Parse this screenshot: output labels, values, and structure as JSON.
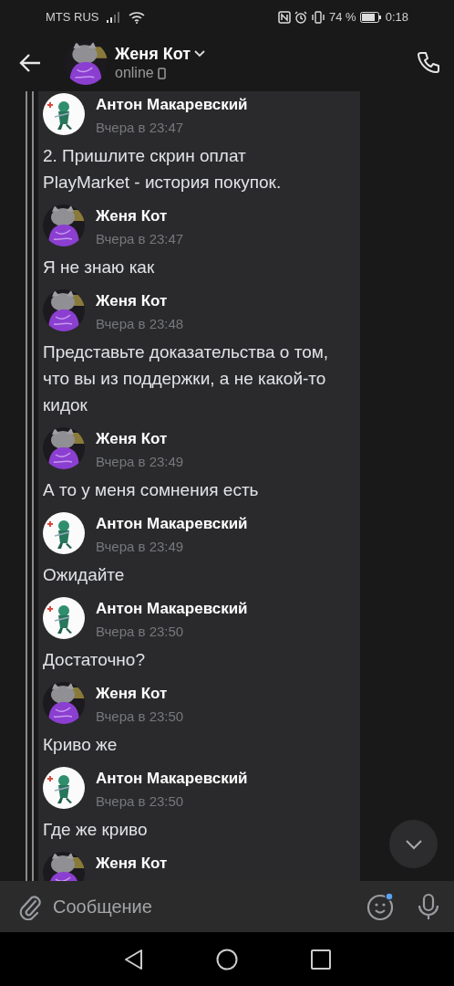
{
  "status_bar": {
    "carrier": "MTS RUS",
    "battery_text": "74 %",
    "time": "0:18"
  },
  "header": {
    "title": "Женя Кот",
    "status": "online"
  },
  "messages": [
    {
      "author": "Антон Макаревский",
      "kind": "light",
      "time": "Вчера в 23:47",
      "text": "2. Пришлите скрин оплат PlayMarket - история покупок."
    },
    {
      "author": "Женя Кот",
      "kind": "dark",
      "time": "Вчера в 23:47",
      "text": "Я не знаю как"
    },
    {
      "author": "Женя Кот",
      "kind": "dark",
      "time": "Вчера в 23:48",
      "text": "Представьте доказательства о том, что вы из поддержки, а не какой-то кидок"
    },
    {
      "author": "Женя Кот",
      "kind": "dark",
      "time": "Вчера в 23:49",
      "text": "А то у меня сомнения есть"
    },
    {
      "author": "Антон Макаревский",
      "kind": "light",
      "time": "Вчера в 23:49",
      "text": "Ожидайте"
    },
    {
      "author": "Антон Макаревский",
      "kind": "light",
      "time": "Вчера в 23:50",
      "text": "Достаточно?"
    },
    {
      "author": "Женя Кот",
      "kind": "dark",
      "time": "Вчера в 23:50",
      "text": "Криво же"
    },
    {
      "author": "Антон Макаревский",
      "kind": "light",
      "time": "Вчера в 23:50",
      "text": "Где же криво"
    },
    {
      "author": "Женя Кот",
      "kind": "dark"
    }
  ],
  "composer": {
    "placeholder": "Сообщение"
  }
}
